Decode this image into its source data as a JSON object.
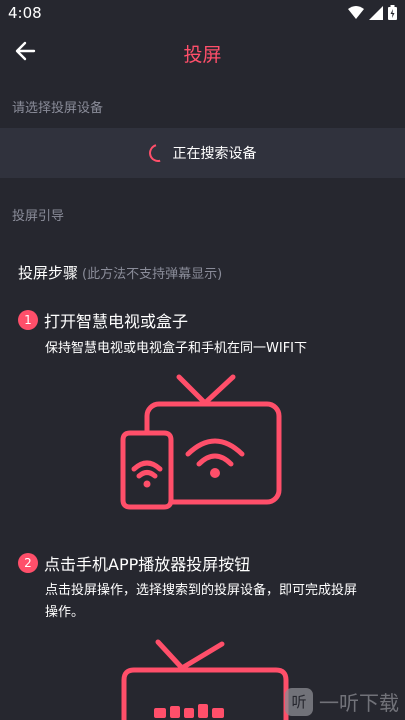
{
  "status": {
    "time": "4:08"
  },
  "header": {
    "title": "投屏"
  },
  "device_section": {
    "label": "请选择投屏设备",
    "search_text": "正在搜索设备"
  },
  "guide_section": {
    "label": "投屏引导"
  },
  "steps": {
    "title": "投屏步骤",
    "note": "(此方法不支持弹幕显示)",
    "items": [
      {
        "number": "1",
        "title": "打开智慧电视或盒子",
        "desc": "保持智慧电视或电视盒子和手机在同一WIFI下"
      },
      {
        "number": "2",
        "title": "点击手机APP播放器投屏按钮",
        "desc": "点击投屏操作，选择搜索到的投屏设备，即可完成投屏操作。"
      }
    ]
  },
  "watermark": {
    "logo_char": "听",
    "text": "一听下载"
  },
  "colors": {
    "accent": "#ff4f6a",
    "background": "#26272f",
    "panel": "#30323d",
    "muted": "#8a8c99"
  }
}
